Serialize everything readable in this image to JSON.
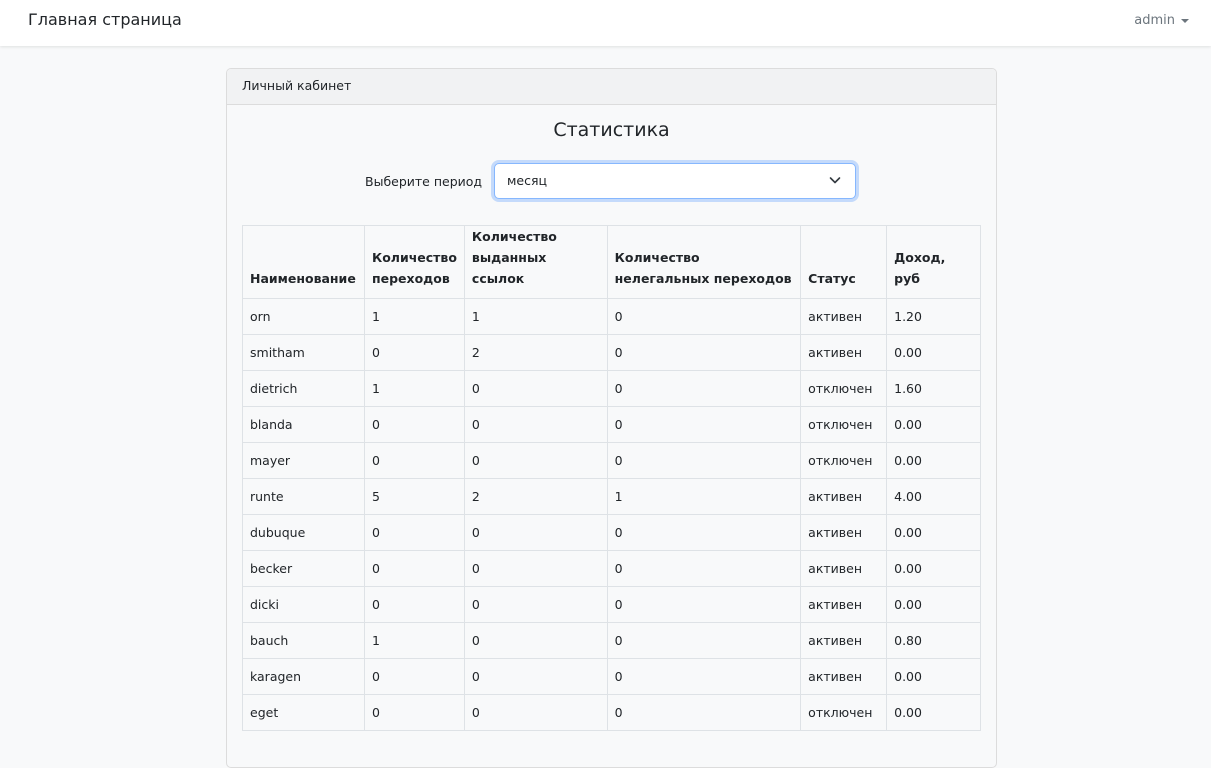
{
  "navbar": {
    "brand": "Главная страница",
    "user": "admin"
  },
  "card": {
    "header": "Личный кабинет",
    "title": "Статистика",
    "period_label": "Выберите период",
    "period_selected": "месяц"
  },
  "table": {
    "headers": [
      "Наименование",
      "Количество переходов",
      "Количество выданных ссылок",
      "Количество нелегальных переходов",
      "Статус",
      "Доход, руб"
    ],
    "rows": [
      [
        "orn",
        "1",
        "1",
        "0",
        "активен",
        "1.20"
      ],
      [
        "smitham",
        "0",
        "2",
        "0",
        "активен",
        "0.00"
      ],
      [
        "dietrich",
        "1",
        "0",
        "0",
        "отключен",
        "1.60"
      ],
      [
        "blanda",
        "0",
        "0",
        "0",
        "отключен",
        "0.00"
      ],
      [
        "mayer",
        "0",
        "0",
        "0",
        "отключен",
        "0.00"
      ],
      [
        "runte",
        "5",
        "2",
        "1",
        "активен",
        "4.00"
      ],
      [
        "dubuque",
        "0",
        "0",
        "0",
        "активен",
        "0.00"
      ],
      [
        "becker",
        "0",
        "0",
        "0",
        "активен",
        "0.00"
      ],
      [
        "dicki",
        "0",
        "0",
        "0",
        "активен",
        "0.00"
      ],
      [
        "bauch",
        "1",
        "0",
        "0",
        "активен",
        "0.80"
      ],
      [
        "karagen",
        "0",
        "0",
        "0",
        "активен",
        "0.00"
      ],
      [
        "eget",
        "0",
        "0",
        "0",
        "отключен",
        "0.00"
      ]
    ]
  },
  "icons": {
    "caret": "caret-down-icon",
    "select_chevron": "chevron-down-icon"
  }
}
